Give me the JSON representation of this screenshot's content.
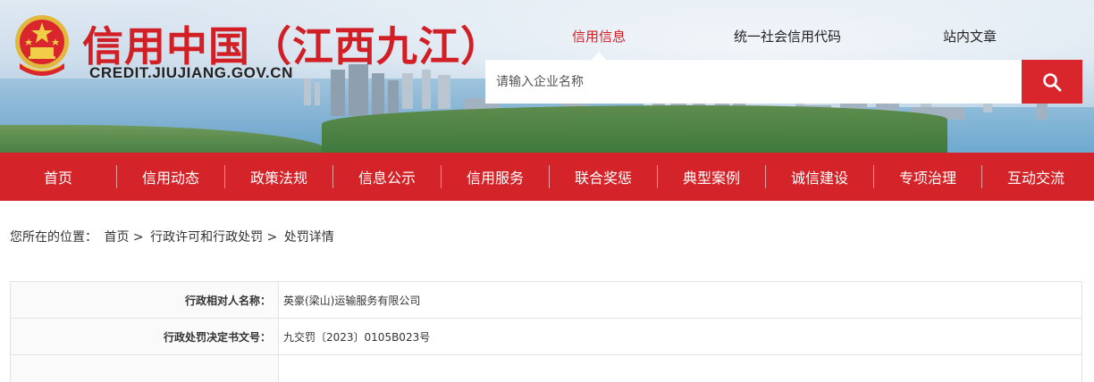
{
  "header": {
    "site_title": "信用中国（江西九江）",
    "site_url": "CREDIT.JIUJIANG.GOV.CN"
  },
  "search": {
    "tabs": [
      {
        "label": "信用信息",
        "active": true
      },
      {
        "label": "统一社会信用代码",
        "active": false
      },
      {
        "label": "站内文章",
        "active": false
      }
    ],
    "placeholder": "请输入企业名称",
    "button_icon": "search-icon"
  },
  "nav": {
    "items": [
      "首页",
      "信用动态",
      "政策法规",
      "信息公示",
      "信用服务",
      "联合奖惩",
      "典型案例",
      "诚信建设",
      "专项治理",
      "互动交流"
    ]
  },
  "breadcrumb": {
    "prefix": "您所在的位置：",
    "items": [
      "首页",
      "行政许可和行政处罚",
      "处罚详情"
    ],
    "separator": ">"
  },
  "detail": {
    "rows": [
      {
        "label": "行政相对人名称：",
        "value": "英豪(梁山)运输服务有限公司"
      },
      {
        "label": "行政处罚决定书文号：",
        "value": "九交罚〔2023〕0105B023号"
      },
      {
        "label": "",
        "value": ""
      }
    ]
  },
  "colors": {
    "brand_red": "#d5232a",
    "title_red": "#d21f25",
    "active_tab": "#d21f25"
  }
}
